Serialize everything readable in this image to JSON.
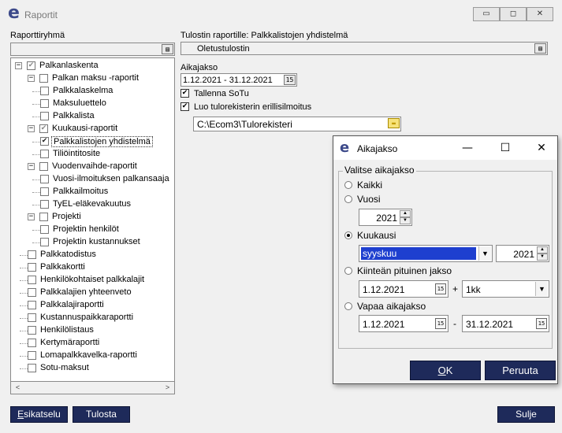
{
  "window": {
    "title": "Raportit",
    "minimize": "▭",
    "maximize": "◻",
    "close": "✕"
  },
  "left": {
    "group_label": "Raporttiryhmä",
    "tree": [
      {
        "label": "Palkanlaskenta",
        "level": 0,
        "expander": "−",
        "check": "gray"
      },
      {
        "label": "Palkan maksu -raportit",
        "level": 1,
        "expander": "−",
        "check": "none"
      },
      {
        "label": "Palkkalaskelma",
        "level": 2,
        "check": "none"
      },
      {
        "label": "Maksuluettelo",
        "level": 2,
        "check": "none"
      },
      {
        "label": "Palkkalista",
        "level": 2,
        "check": "none"
      },
      {
        "label": "Kuukausi-raportit",
        "level": 1,
        "expander": "−",
        "check": "gray"
      },
      {
        "label": "Palkkalistojen yhdistelmä",
        "level": 2,
        "check": "on",
        "selected": true
      },
      {
        "label": "Tiliöintitosite",
        "level": 2,
        "check": "none"
      },
      {
        "label": "Vuodenvaihde-raportit",
        "level": 1,
        "expander": "−",
        "check": "none"
      },
      {
        "label": "Vuosi-ilmoituksen palkansaaja",
        "level": 2,
        "check": "none"
      },
      {
        "label": "Palkkailmoitus",
        "level": 2,
        "check": "none"
      },
      {
        "label": "TyEL-eläkevakuutus",
        "level": 2,
        "check": "none"
      },
      {
        "label": "Projekti",
        "level": 1,
        "expander": "−",
        "check": "none"
      },
      {
        "label": "Projektin henkilöt",
        "level": 2,
        "check": "none"
      },
      {
        "label": "Projektin kustannukset",
        "level": 2,
        "check": "none"
      },
      {
        "label": "Palkkatodistus",
        "level": 1,
        "check": "none"
      },
      {
        "label": "Palkkakortti",
        "level": 1,
        "check": "none"
      },
      {
        "label": "Henkilökohtaiset palkkalajit",
        "level": 1,
        "check": "none"
      },
      {
        "label": "Palkkalajien yhteenveto",
        "level": 1,
        "check": "none"
      },
      {
        "label": "Palkkalajiraportti",
        "level": 1,
        "check": "none"
      },
      {
        "label": "Kustannuspaikkaraportti",
        "level": 1,
        "check": "none"
      },
      {
        "label": "Henkilölistaus",
        "level": 1,
        "check": "none"
      },
      {
        "label": "Kertymäraportti",
        "level": 1,
        "check": "none"
      },
      {
        "label": "Lomapalkkavelka-raportti",
        "level": 1,
        "check": "none"
      },
      {
        "label": "Sotu-maksut",
        "level": 1,
        "check": "none"
      }
    ],
    "scroll_left": "<",
    "scroll_right": ">"
  },
  "right": {
    "printer_label": "Tulostin raportille: Palkkalistojen yhdistelmä",
    "printer_value": "Oletustulostin",
    "period_label": "Aikajakso",
    "period_value": "1.12.2021 - 31.12.2021",
    "save_sotu_label": "Tallenna SoTu",
    "create_register_label": "Luo tulorekisterin erillisilmoitus",
    "path_value": "C:\\Ecom3\\Tulorekisteri"
  },
  "buttons": {
    "preview_pre": "",
    "preview_u": "E",
    "preview_post": "sikatselu",
    "print": "Tulosta",
    "close": "Sulje"
  },
  "dialog": {
    "title": "Aikajakso",
    "minimize": "—",
    "maximize": "☐",
    "close": "✕",
    "group_legend": "Valitse aikajakso",
    "opt_all": "Kaikki",
    "opt_year": "Vuosi",
    "year_value": "2021",
    "opt_month": "Kuukausi",
    "month_value": "syyskuu",
    "month_year_value": "2021",
    "opt_fixed": "Kiinteän pituinen jakso",
    "fixed_start": "1.12.2021",
    "plus": "+",
    "fixed_length": "1kk",
    "opt_free": "Vapaa aikajakso",
    "free_start": "1.12.2021",
    "dash": "-",
    "free_end": "31.12.2021",
    "ok_u": "O",
    "ok_post": "K",
    "cancel": "Peruuta"
  }
}
